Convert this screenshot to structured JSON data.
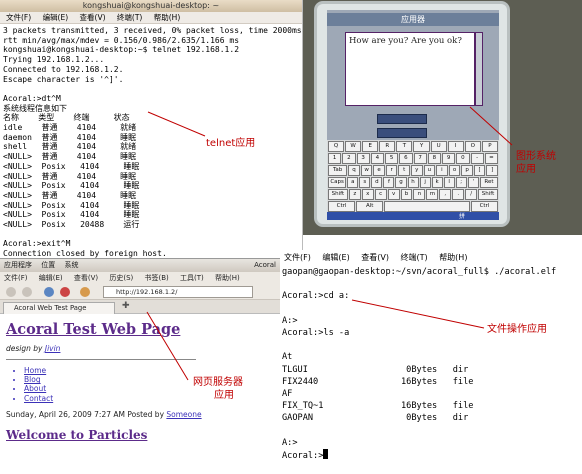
{
  "telnet_terminal": {
    "title": "kongshuai@kongshuai-desktop: ~",
    "menu": [
      "文件(F)",
      "编辑(E)",
      "查看(V)",
      "终端(T)",
      "帮助(H)"
    ],
    "lines": [
      "3 packets transmitted, 3 received, 0% packet loss, time 2000ms",
      "rtt min/avg/max/mdev = 0.156/0.986/2.635/1.166 ms",
      "kongshuai@kongshuai-desktop:~$ telnet 192.168.1.2",
      "Trying 192.168.1.2...",
      "Connected to 192.168.1.2.",
      "Escape character is '^]'.",
      "",
      "Acoral:>dt^M",
      "系统线程信息如下",
      "名称    类型    终端     状态",
      "idle    普通    4104     就绪",
      "daemon  普通    4104     睡眠",
      "shell   普通    4104     就绪",
      "<NULL>  普通    4104     睡眠",
      "<NULL>  Posix   4104     睡眠",
      "<NULL>  普通    4104     睡眠",
      "<NULL>  Posix   4104     睡眠",
      "<NULL>  普通    4104     睡眠",
      "<NULL>  Posix   4104     睡眠",
      "<NULL>  Posix   4104     睡眠",
      "<NULL>  Posix   20488    运行",
      "",
      "Acoral:>exit^M",
      "Connection closed by foreign host."
    ]
  },
  "device": {
    "window_title": "应用器",
    "textarea_text": "How are you? Are you ok?",
    "keyboard_rows": [
      [
        "Q",
        "W",
        "E",
        "R",
        "T",
        "Y",
        "U",
        "I",
        "O",
        "P"
      ],
      [
        "1",
        "2",
        "3",
        "4",
        "5",
        "6",
        "7",
        "8",
        "9",
        "0",
        "-",
        "="
      ],
      [
        "Tab",
        "q",
        "w",
        "e",
        "r",
        "t",
        "y",
        "u",
        "i",
        "o",
        "p",
        "[",
        "]"
      ],
      [
        "Caps",
        "a",
        "s",
        "d",
        "f",
        "g",
        "h",
        "j",
        "k",
        "l",
        ";",
        "'",
        "Ret"
      ],
      [
        "Shift",
        "z",
        "x",
        "c",
        "v",
        "b",
        "n",
        "m",
        ",",
        ".",
        "/",
        "Shift"
      ],
      [
        "Ctrl",
        "Alt",
        " ",
        "Ctrl"
      ],
      [
        "Ctrl",
        "Alt"
      ]
    ],
    "taskbar_label": "拼"
  },
  "browser": {
    "panel_menu": [
      "应用程序",
      "位置",
      "系统"
    ],
    "panel_right": "Acoral",
    "menu": [
      "文件(F)",
      "编辑(E)",
      "查看(V)",
      "历史(S)",
      "书签(B)",
      "工具(T)",
      "帮助(H)"
    ],
    "url": "http://192.168.1.2/",
    "tab_title": "Acoral Web Test Page",
    "page_title": "Acoral Test Web Page",
    "design_prefix": "design by ",
    "design_author": "Jivin",
    "links": [
      "Home",
      "Blog",
      "About",
      "Contact"
    ],
    "post_date": "Sunday, April 26, 2009 7:27 AM Posted by ",
    "post_author": "Someone",
    "post_title": "Welcome to Particles"
  },
  "file_terminal": {
    "menu": [
      "文件(F)",
      "编辑(E)",
      "查看(V)",
      "终端(T)",
      "帮助(H)"
    ],
    "lines": [
      "gaopan@gaopan-desktop:~/svn/acoral_full$ ./acoral.elf",
      "",
      "Acoral:>cd a:",
      "",
      "A:>",
      "Acoral:>ls -a",
      "",
      "At",
      "TLGUI                   0Bytes   dir",
      "FIX2440                16Bytes   file",
      "AF",
      "FIX_TQ~1               16Bytes   file",
      "GAOPAN                  0Bytes   dir",
      "",
      "A:>",
      "Acoral:>"
    ]
  },
  "annotations": {
    "telnet": "telnet应用",
    "graphics_line1": "图形系统",
    "graphics_line2": "应用",
    "file_ops": "文件操作应用",
    "web_line1": "网页服务器",
    "web_line2": "应用"
  },
  "colors": {
    "annotation": "#c00000",
    "link": "#3b31b8",
    "heading": "#5c2b8a"
  }
}
